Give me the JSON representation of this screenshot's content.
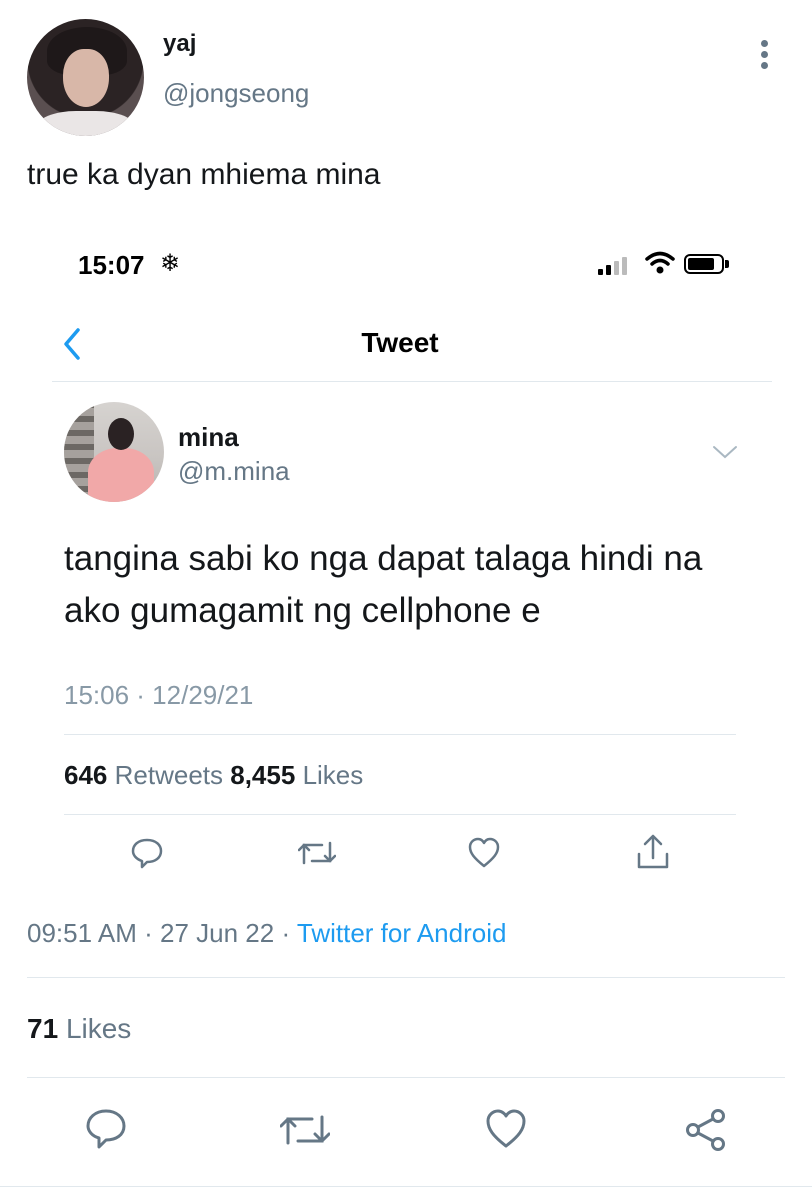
{
  "outer_tweet": {
    "author_name": "yaj",
    "author_handle": "@jongseong",
    "text": "true ka dyan mhiema mina",
    "time": "09:51 AM",
    "date": "27 Jun 22",
    "separator": "·",
    "source": "Twitter for Android",
    "likes_count": "71",
    "likes_label": "Likes"
  },
  "embedded_screenshot": {
    "status_time": "15:07",
    "status_icon": "❄",
    "page_title": "Tweet",
    "tweet": {
      "author_name": "mina",
      "author_handle": "@m.mina",
      "text": "tangina sabi ko nga dapat talaga hindi na ako gumagamit ng cellphone e",
      "timestamp": "15:06 · 12/29/21",
      "retweets_count": "646",
      "retweets_label": "Retweets",
      "likes_count": "8,455",
      "likes_label": "Likes"
    }
  },
  "colors": {
    "text": "#14171a",
    "secondary": "#657786",
    "link": "#1d9bf0",
    "divider": "#e1e8ed"
  },
  "icons": {
    "outer_actions": [
      "reply-icon",
      "retweet-icon",
      "like-icon",
      "share-icon"
    ],
    "inner_actions": [
      "reply-icon",
      "retweet-icon",
      "like-icon",
      "upload-icon"
    ]
  }
}
